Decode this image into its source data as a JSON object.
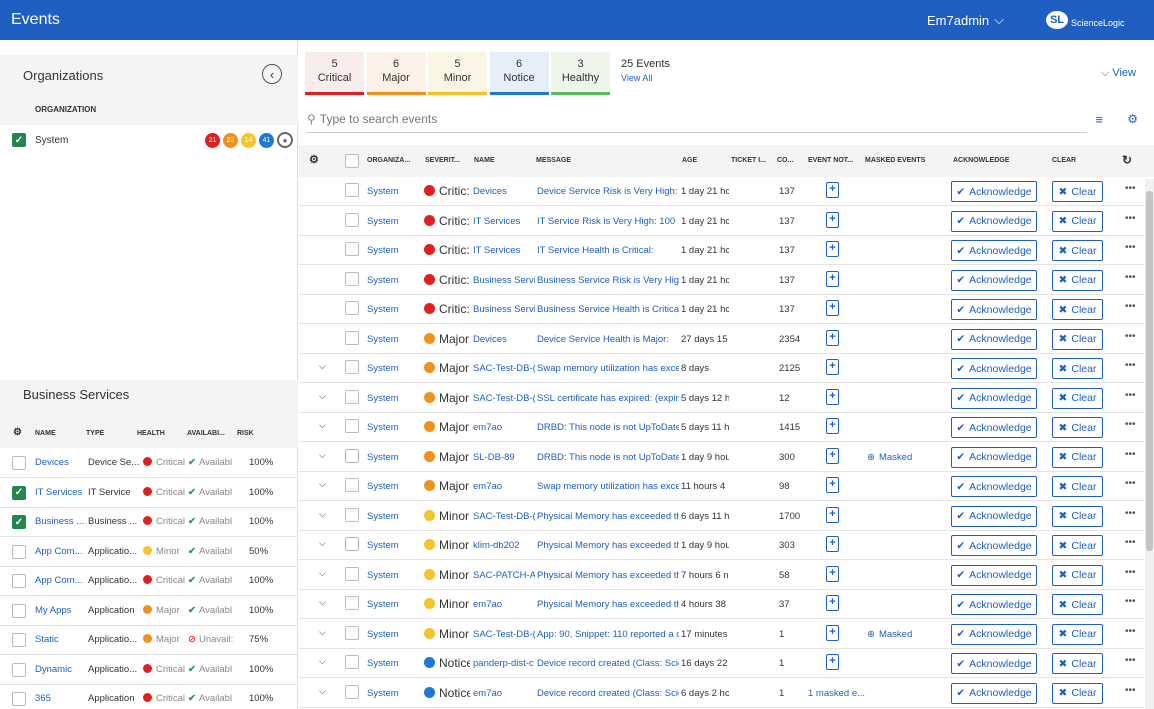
{
  "header": {
    "title": "Events",
    "user": "Em7admin",
    "logo_mark": "SL",
    "logo_text": "ScienceLogic"
  },
  "organizations": {
    "title": "Organizations",
    "column": "ORGANIZATION",
    "rows": [
      {
        "name": "System",
        "counts": [
          "21",
          "23",
          "14",
          "41"
        ]
      }
    ]
  },
  "business_services": {
    "title": "Business Services",
    "columns": {
      "name": "NAME",
      "type": "TYPE",
      "health": "HEALTH",
      "availability": "AVAILABI...",
      "risk": "RISK"
    },
    "rows": [
      {
        "name": "Devices",
        "type": "Device Se...",
        "health": "Critical",
        "availability": "Availabl",
        "risk": "100%"
      },
      {
        "name": "IT Services",
        "type": "IT Service",
        "health": "Critical",
        "availability": "Availabl",
        "risk": "100%"
      },
      {
        "name": "Business ...",
        "type": "Business ...",
        "health": "Critical",
        "availability": "Availabl",
        "risk": "100%"
      },
      {
        "name": "App Com...",
        "type": "Applicatio...",
        "health": "Minor",
        "availability": "Availabl",
        "risk": "50%"
      },
      {
        "name": "App Com...",
        "type": "Applicatio...",
        "health": "Critical",
        "availability": "Availabl",
        "risk": "100%"
      },
      {
        "name": "My Apps",
        "type": "Application",
        "health": "Major",
        "availability": "Availabl",
        "risk": "100%"
      },
      {
        "name": "Static",
        "type": "Applicatio...",
        "health": "Major",
        "availability": "Unavail:",
        "risk": "75%"
      },
      {
        "name": "Dynamic",
        "type": "Applicatio...",
        "health": "Critical",
        "availability": "Availabl",
        "risk": "100%"
      },
      {
        "name": "365",
        "type": "Application",
        "health": "Critical",
        "availability": "Availabl",
        "risk": "100%"
      }
    ]
  },
  "severity_tabs": [
    {
      "count": "5",
      "label": "Critical"
    },
    {
      "count": "6",
      "label": "Major"
    },
    {
      "count": "5",
      "label": "Minor"
    },
    {
      "count": "6",
      "label": "Notice"
    },
    {
      "count": "3",
      "label": "Healthy"
    }
  ],
  "events_summary": {
    "count_label": "25 Events",
    "view_all": "View All",
    "view_button": "View"
  },
  "search": {
    "placeholder": "Type to search events"
  },
  "table": {
    "columns": {
      "org": "ORGANIZA...",
      "severity": "SEVERIT...",
      "name": "NAME",
      "message": "MESSAGE",
      "age": "AGE",
      "ticket": "TICKET I...",
      "count": "CO...",
      "notes": "EVENT NOT...",
      "masked": "MASKED EVENTS",
      "ack": "ACKNOWLEDGE",
      "clear": "CLEAR"
    },
    "ack_label": "Acknowledge",
    "clear_label": "Clear",
    "rows": [
      {
        "org": "System",
        "severity": "Critic:",
        "name": "Devices",
        "message": "Device Service Risk is Very High: 1...",
        "age": "1 day 21 hc",
        "count": "137",
        "masked": "",
        "expand": false
      },
      {
        "org": "System",
        "severity": "Critic:",
        "name": "IT Services",
        "message": "IT Service Risk is Very High: 100",
        "age": "1 day 21 hc",
        "count": "137",
        "masked": "",
        "expand": false
      },
      {
        "org": "System",
        "severity": "Critic:",
        "name": "IT Services",
        "message": "IT Service Health is Critical:",
        "age": "1 day 21 hc",
        "count": "137",
        "masked": "",
        "expand": false
      },
      {
        "org": "System",
        "severity": "Critic:",
        "name": "Business Servi",
        "message": "Business Service Risk is Very High:...",
        "age": "1 day 21 hc",
        "count": "137",
        "masked": "",
        "expand": false
      },
      {
        "org": "System",
        "severity": "Critic:",
        "name": "Business Servi",
        "message": "Business Service Health is Critical:",
        "age": "1 day 21 hc",
        "count": "137",
        "masked": "",
        "expand": false
      },
      {
        "org": "System",
        "severity": "Major",
        "name": "Devices",
        "message": "Device Service Health is Major:",
        "age": "27 days 15",
        "count": "2354",
        "masked": "",
        "expand": false
      },
      {
        "org": "System",
        "severity": "Major",
        "name": "SAC-Test-DB-(",
        "message": "Swap memory utilization has exce...",
        "age": "8 days",
        "count": "2125",
        "masked": "",
        "expand": true
      },
      {
        "org": "System",
        "severity": "Major",
        "name": "SAC-Test-DB-(",
        "message": "SSL certificate has expired: (expire...",
        "age": "5 days 12 h",
        "count": "12",
        "masked": "",
        "expand": true
      },
      {
        "org": "System",
        "severity": "Major",
        "name": "em7ao",
        "message": "DRBD: This node is not UpToDate",
        "age": "5 days 11 h",
        "count": "1415",
        "masked": "",
        "expand": true
      },
      {
        "org": "System",
        "severity": "Major",
        "name": "SL-DB-89",
        "message": "DRBD: This node is not UpToDate",
        "age": "1 day 9 hou",
        "count": "300",
        "masked": "Masked",
        "expand": true
      },
      {
        "org": "System",
        "severity": "Major",
        "name": "em7ao",
        "message": "Swap memory utilization has exce...",
        "age": "11 hours 4",
        "count": "98",
        "masked": "",
        "expand": true
      },
      {
        "org": "System",
        "severity": "Minor",
        "name": "SAC-Test-DB-(",
        "message": "Physical Memory has exceeded th...",
        "age": "6 days 11 h",
        "count": "1700",
        "masked": "",
        "expand": true
      },
      {
        "org": "System",
        "severity": "Minor",
        "name": "klim-db202",
        "message": "Physical Memory has exceeded th...",
        "age": "1 day 9 hou",
        "count": "303",
        "masked": "",
        "expand": true
      },
      {
        "org": "System",
        "severity": "Minor",
        "name": "SAC-PATCH-A",
        "message": "Physical Memory has exceeded th...",
        "age": "7 hours 6 n",
        "count": "58",
        "masked": "",
        "expand": true
      },
      {
        "org": "System",
        "severity": "Minor",
        "name": "em7ao",
        "message": "Physical Memory has exceeded th...",
        "age": "4 hours 38",
        "count": "37",
        "masked": "",
        "expand": true
      },
      {
        "org": "System",
        "severity": "Minor",
        "name": "SAC-Test-DB-(",
        "message": "App: 90, Snippet: 110 reported a c...",
        "age": "17 minutes",
        "count": "1",
        "masked": "Masked",
        "expand": true
      },
      {
        "org": "System",
        "severity": "Notice",
        "name": "panderp-dist-c",
        "message": "Device record created (Class: Scie...",
        "age": "16 days 22",
        "count": "1",
        "masked": "",
        "expand": true
      },
      {
        "org": "System",
        "severity": "Notice",
        "name": "em7ao",
        "message": "Device record created (Class: Scie...",
        "age": "6 days 2 hc",
        "count": "1",
        "masked": "",
        "note_text": "1 masked e...",
        "expand": true
      }
    ]
  },
  "colors": {
    "header": "#1f5fc2",
    "critical": "#e02020",
    "major": "#f0901e",
    "minor": "#f5c32c",
    "notice": "#1e78d6",
    "healthy": "#5cb85c",
    "link": "#1e5fbf",
    "checked": "#23864f"
  }
}
